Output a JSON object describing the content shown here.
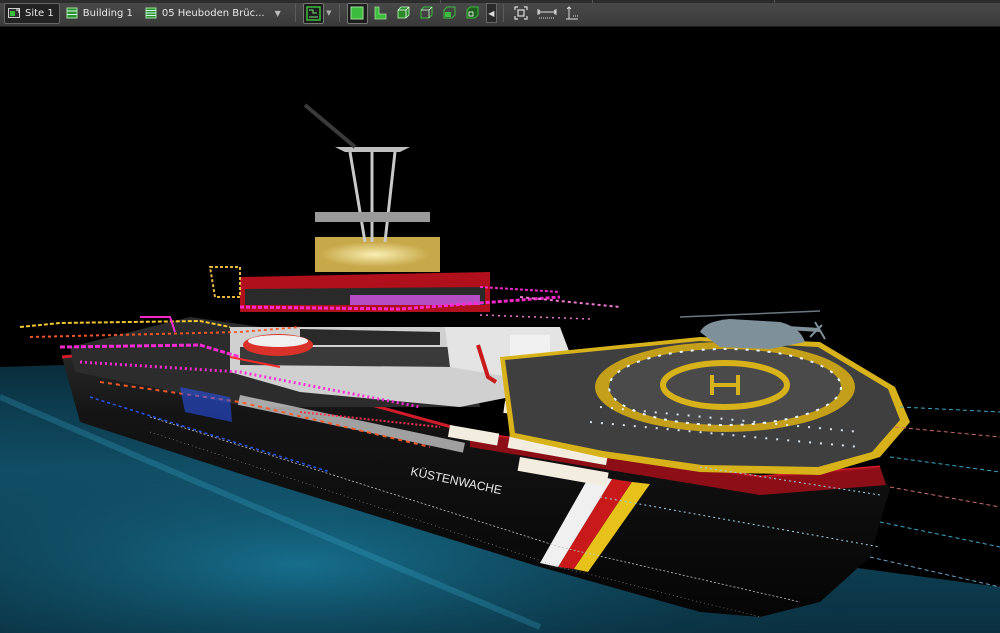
{
  "toolbar": {
    "site_label": "Site 1",
    "building_label": "Building 1",
    "storey_label": "05 Heuboden Brüc...",
    "view_mode_selected": "floor-plan-view",
    "view_buttons": [
      "wall-view",
      "corner-view",
      "box-view-1",
      "box-view-2",
      "box-view-3",
      "box-view-4"
    ],
    "right_tools": [
      "fit-view",
      "measure-horizontal",
      "measure-vertical"
    ]
  },
  "colors": {
    "toolbar_bg": "#3d3d3d",
    "accent_green": "#3cbc3c",
    "water": "#0f4556",
    "hull": "#0d0d0d",
    "helideck_yellow": "#d8b21a",
    "magenta": "#ff2bd6",
    "cyan_dimension": "#39a7c8"
  },
  "scene": {
    "hull_lettering": "KÜSTENWACHE"
  }
}
